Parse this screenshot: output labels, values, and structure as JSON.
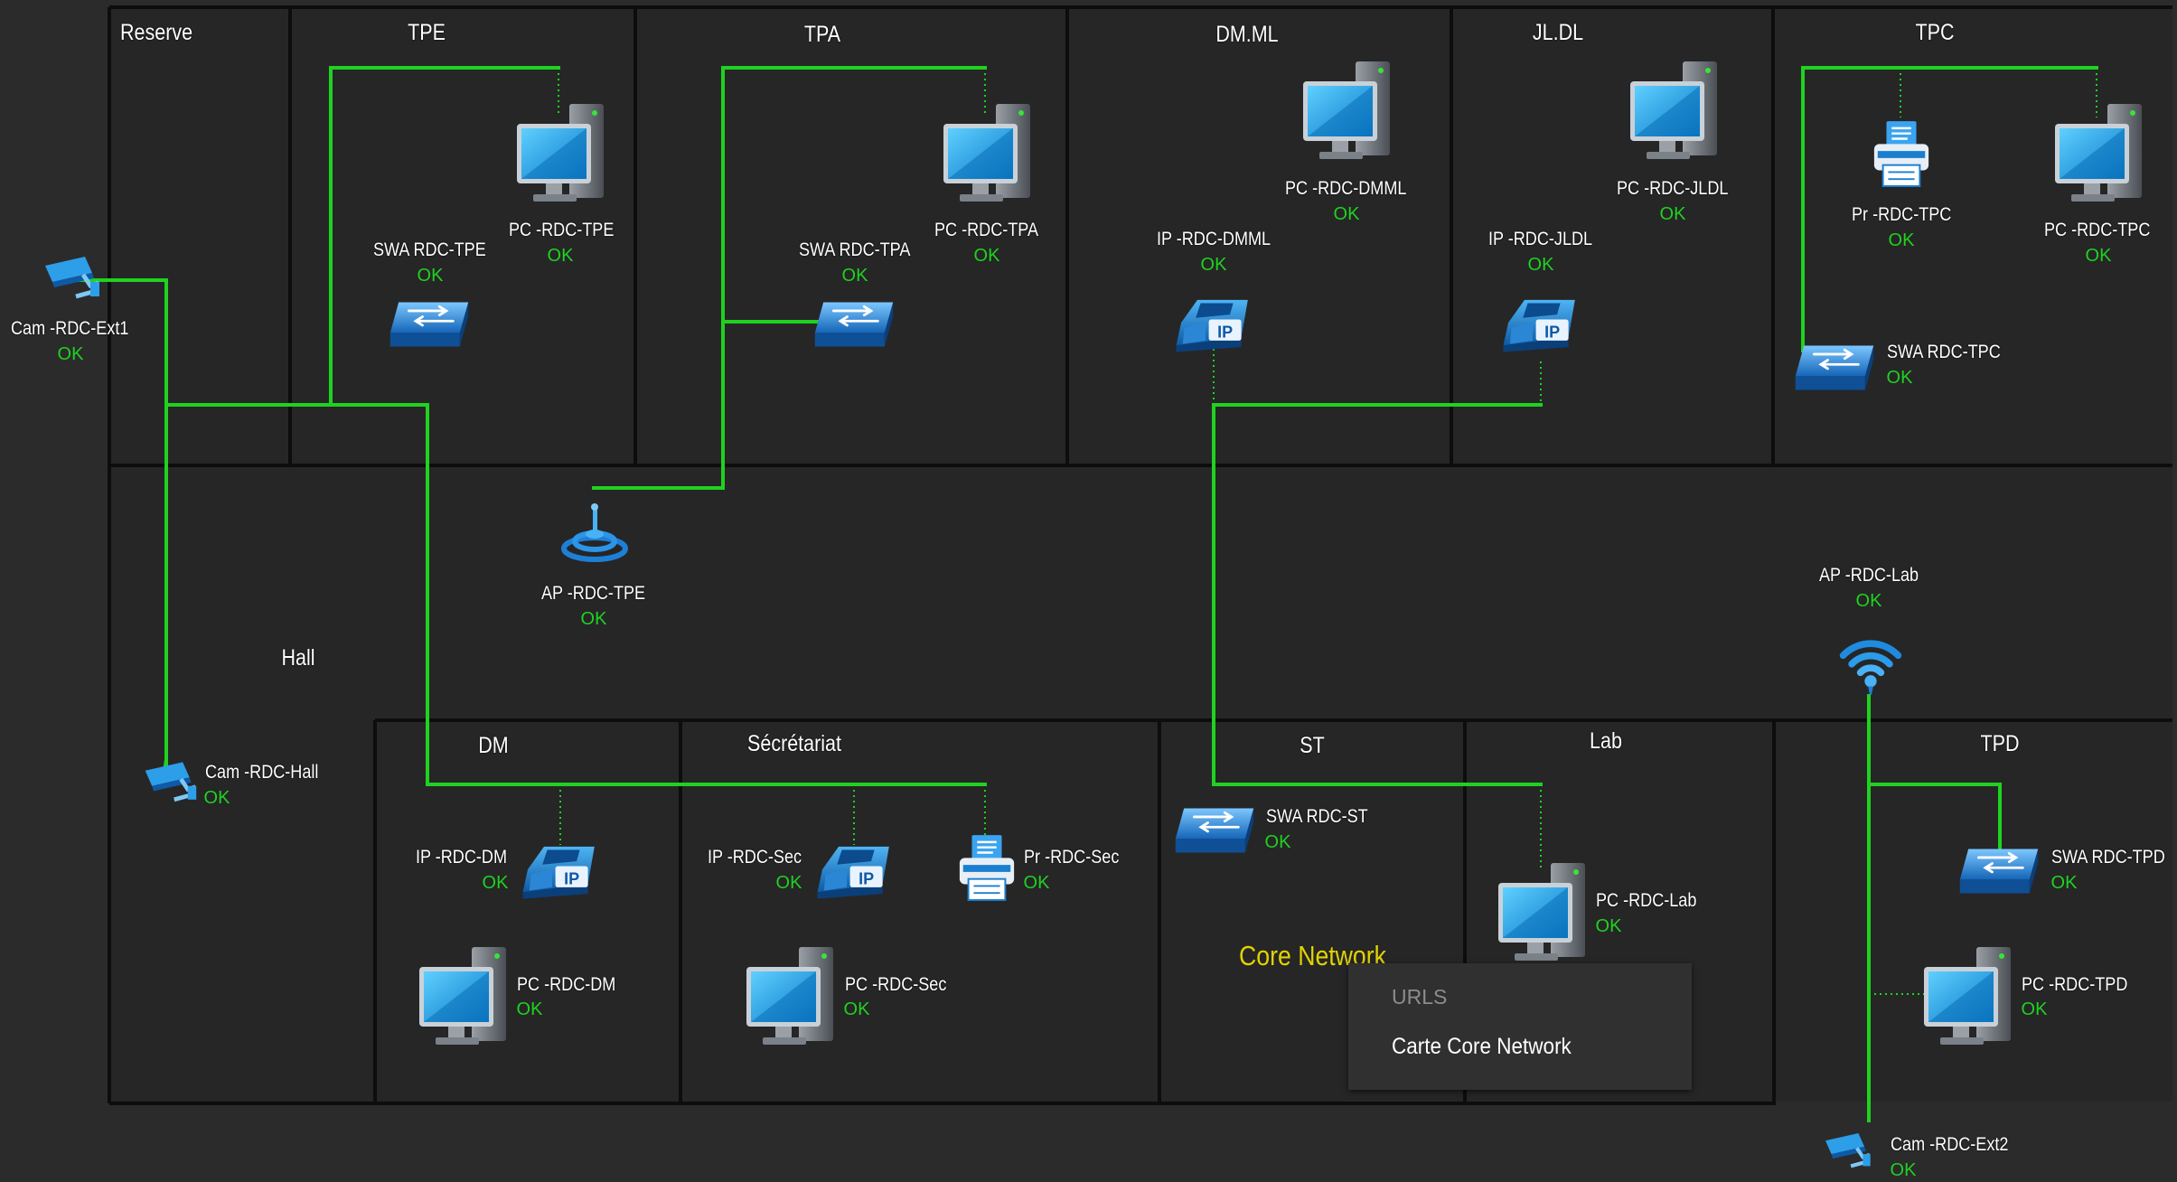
{
  "rooms": [
    {
      "id": "reserve",
      "label": "Reserve"
    },
    {
      "id": "tpe",
      "label": "TPE"
    },
    {
      "id": "tpa",
      "label": "TPA"
    },
    {
      "id": "dmml",
      "label": "DM.ML"
    },
    {
      "id": "jldl",
      "label": "JL.DL"
    },
    {
      "id": "tpc",
      "label": "TPC"
    },
    {
      "id": "hall",
      "label": "Hall"
    },
    {
      "id": "dm",
      "label": "DM"
    },
    {
      "id": "secretariat",
      "label": "Sécrétariat"
    },
    {
      "id": "st",
      "label": "ST"
    },
    {
      "id": "lab",
      "label": "Lab"
    },
    {
      "id": "tpd",
      "label": "TPD"
    }
  ],
  "devices": [
    {
      "id": "cam-ext1",
      "kind": "camera",
      "name": "Cam -RDC-Ext1",
      "status": "OK"
    },
    {
      "id": "swa-tpe",
      "kind": "switch",
      "name": "SWA RDC-TPE",
      "status": "OK"
    },
    {
      "id": "pc-tpe",
      "kind": "pc",
      "name": "PC -RDC-TPE",
      "status": "OK"
    },
    {
      "id": "swa-tpa",
      "kind": "switch",
      "name": "SWA RDC-TPA",
      "status": "OK"
    },
    {
      "id": "pc-tpa",
      "kind": "pc",
      "name": "PC -RDC-TPA",
      "status": "OK"
    },
    {
      "id": "pc-dmml",
      "kind": "pc",
      "name": "PC -RDC-DMML",
      "status": "OK"
    },
    {
      "id": "ip-dmml",
      "kind": "phone",
      "name": "IP -RDC-DMML",
      "status": "OK"
    },
    {
      "id": "pc-jldl",
      "kind": "pc",
      "name": "PC -RDC-JLDL",
      "status": "OK"
    },
    {
      "id": "ip-jldl",
      "kind": "phone",
      "name": "IP -RDC-JLDL",
      "status": "OK"
    },
    {
      "id": "pr-tpc",
      "kind": "printer",
      "name": "Pr -RDC-TPC",
      "status": "OK"
    },
    {
      "id": "pc-tpc",
      "kind": "pc",
      "name": "PC -RDC-TPC",
      "status": "OK"
    },
    {
      "id": "swa-tpc",
      "kind": "switch",
      "name": "SWA RDC-TPC",
      "status": "OK"
    },
    {
      "id": "ap-tpe",
      "kind": "ap",
      "name": "AP -RDC-TPE",
      "status": "OK"
    },
    {
      "id": "ap-lab",
      "kind": "ap",
      "name": "AP -RDC-Lab",
      "status": "OK"
    },
    {
      "id": "cam-hall",
      "kind": "camera",
      "name": "Cam -RDC-Hall",
      "status": "OK"
    },
    {
      "id": "ip-dm",
      "kind": "phone",
      "name": "IP -RDC-DM",
      "status": "OK"
    },
    {
      "id": "pc-dm",
      "kind": "pc",
      "name": "PC -RDC-DM",
      "status": "OK"
    },
    {
      "id": "ip-sec",
      "kind": "phone",
      "name": "IP -RDC-Sec",
      "status": "OK"
    },
    {
      "id": "pr-sec",
      "kind": "printer",
      "name": "Pr -RDC-Sec",
      "status": "OK"
    },
    {
      "id": "pc-sec",
      "kind": "pc",
      "name": "PC -RDC-Sec",
      "status": "OK"
    },
    {
      "id": "swa-st",
      "kind": "switch",
      "name": "SWA RDC-ST",
      "status": "OK"
    },
    {
      "id": "pc-lab",
      "kind": "pc",
      "name": "PC -RDC-Lab",
      "status": "OK"
    },
    {
      "id": "swa-tpd",
      "kind": "switch",
      "name": "SWA RDC-TPD",
      "status": "OK"
    },
    {
      "id": "pc-tpd",
      "kind": "pc",
      "name": "PC -RDC-TPD",
      "status": "OK"
    },
    {
      "id": "cam-ext2",
      "kind": "camera",
      "name": "Cam -RDC-Ext2",
      "status": "OK"
    }
  ],
  "core_network_label": "Core Network",
  "context_menu": {
    "header": "URLS",
    "items": [
      "Carte Core Network"
    ]
  },
  "colors": {
    "background": "#2b2b2c",
    "room_fill": "#262627",
    "wall": "#0d0d0d",
    "link": "#1fd21f",
    "status_ok": "#1fd21f",
    "device_blue": "#1e9be0",
    "core_label": "#e1d300"
  }
}
